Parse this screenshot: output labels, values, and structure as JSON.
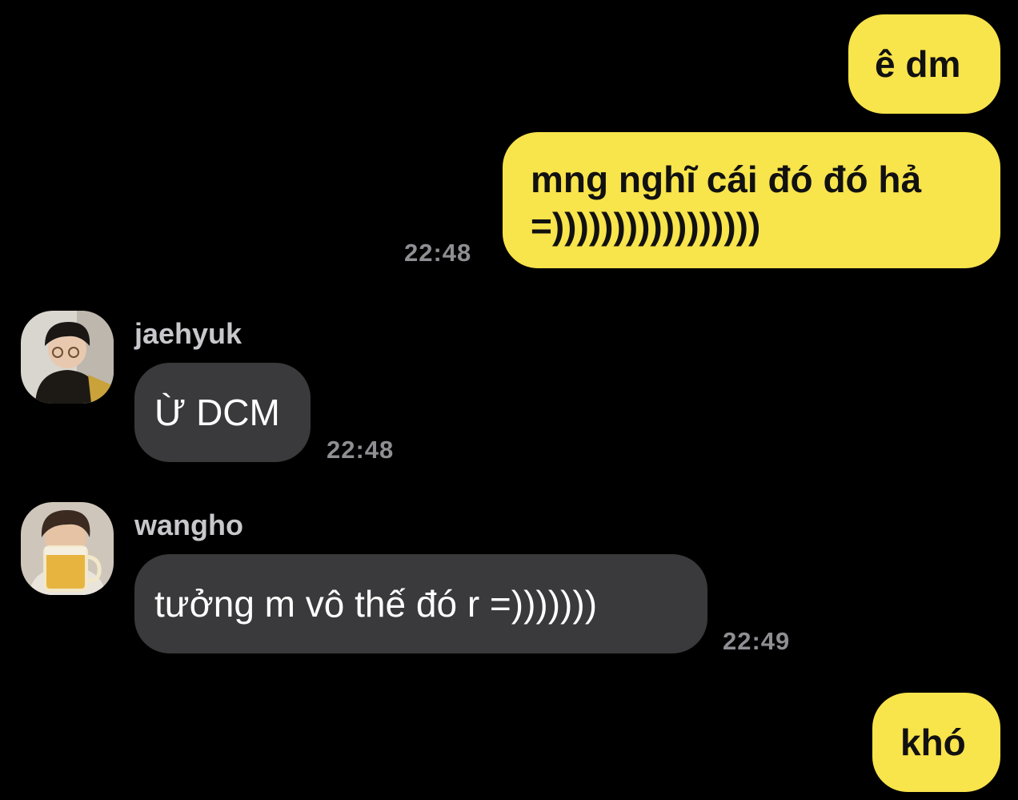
{
  "colors": {
    "background": "#000000",
    "outgoing_bubble": "#f8e44b",
    "incoming_bubble": "#3a3a3c",
    "timestamp": "#8e8e93",
    "sender_name": "#c7c7cc"
  },
  "messages": [
    {
      "direction": "outgoing",
      "text": "ê dm"
    },
    {
      "direction": "outgoing",
      "text_line1": "mng nghĩ cái đó đó hả",
      "text_line2": "=)))))))))))))))))",
      "time": "22:48"
    },
    {
      "direction": "incoming",
      "sender": "jaehyuk",
      "text": "Ừ DCM",
      "time": "22:48"
    },
    {
      "direction": "incoming",
      "sender": "wangho",
      "text": "tưởng m vô thế đó r =)))))))",
      "time": "22:49"
    },
    {
      "direction": "outgoing",
      "text": "khó"
    }
  ]
}
